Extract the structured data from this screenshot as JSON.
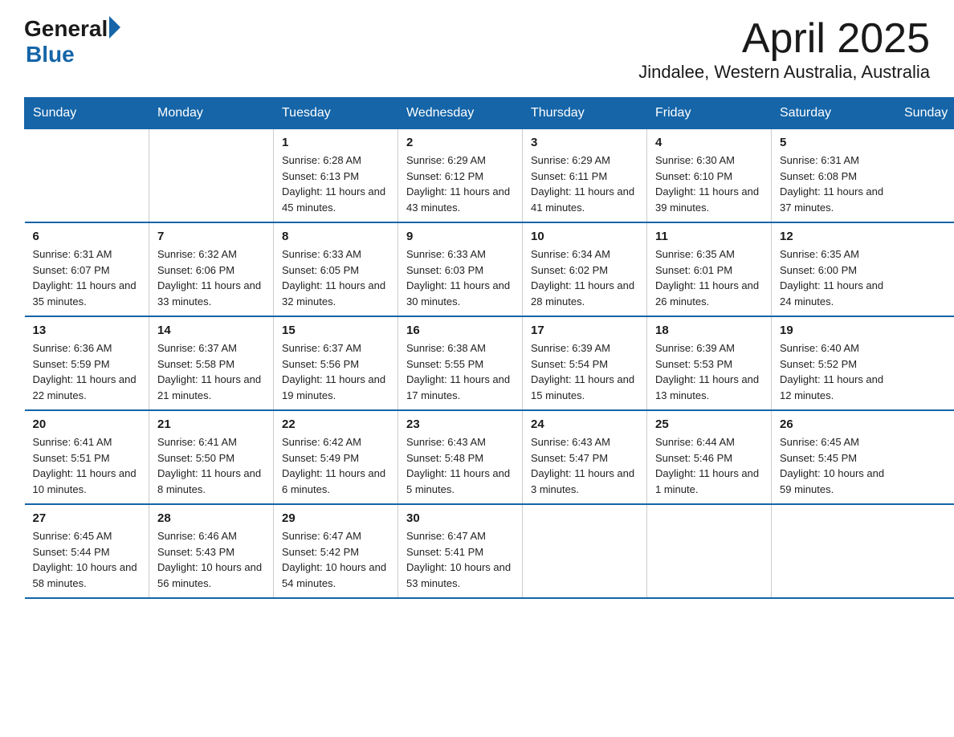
{
  "header": {
    "logo_general": "General",
    "logo_blue": "Blue",
    "month_title": "April 2025",
    "location": "Jindalee, Western Australia, Australia"
  },
  "days_of_week": [
    "Sunday",
    "Monday",
    "Tuesday",
    "Wednesday",
    "Thursday",
    "Friday",
    "Saturday"
  ],
  "weeks": [
    [
      {
        "day": "",
        "sunrise": "",
        "sunset": "",
        "daylight": ""
      },
      {
        "day": "",
        "sunrise": "",
        "sunset": "",
        "daylight": ""
      },
      {
        "day": "1",
        "sunrise": "Sunrise: 6:28 AM",
        "sunset": "Sunset: 6:13 PM",
        "daylight": "Daylight: 11 hours and 45 minutes."
      },
      {
        "day": "2",
        "sunrise": "Sunrise: 6:29 AM",
        "sunset": "Sunset: 6:12 PM",
        "daylight": "Daylight: 11 hours and 43 minutes."
      },
      {
        "day": "3",
        "sunrise": "Sunrise: 6:29 AM",
        "sunset": "Sunset: 6:11 PM",
        "daylight": "Daylight: 11 hours and 41 minutes."
      },
      {
        "day": "4",
        "sunrise": "Sunrise: 6:30 AM",
        "sunset": "Sunset: 6:10 PM",
        "daylight": "Daylight: 11 hours and 39 minutes."
      },
      {
        "day": "5",
        "sunrise": "Sunrise: 6:31 AM",
        "sunset": "Sunset: 6:08 PM",
        "daylight": "Daylight: 11 hours and 37 minutes."
      }
    ],
    [
      {
        "day": "6",
        "sunrise": "Sunrise: 6:31 AM",
        "sunset": "Sunset: 6:07 PM",
        "daylight": "Daylight: 11 hours and 35 minutes."
      },
      {
        "day": "7",
        "sunrise": "Sunrise: 6:32 AM",
        "sunset": "Sunset: 6:06 PM",
        "daylight": "Daylight: 11 hours and 33 minutes."
      },
      {
        "day": "8",
        "sunrise": "Sunrise: 6:33 AM",
        "sunset": "Sunset: 6:05 PM",
        "daylight": "Daylight: 11 hours and 32 minutes."
      },
      {
        "day": "9",
        "sunrise": "Sunrise: 6:33 AM",
        "sunset": "Sunset: 6:03 PM",
        "daylight": "Daylight: 11 hours and 30 minutes."
      },
      {
        "day": "10",
        "sunrise": "Sunrise: 6:34 AM",
        "sunset": "Sunset: 6:02 PM",
        "daylight": "Daylight: 11 hours and 28 minutes."
      },
      {
        "day": "11",
        "sunrise": "Sunrise: 6:35 AM",
        "sunset": "Sunset: 6:01 PM",
        "daylight": "Daylight: 11 hours and 26 minutes."
      },
      {
        "day": "12",
        "sunrise": "Sunrise: 6:35 AM",
        "sunset": "Sunset: 6:00 PM",
        "daylight": "Daylight: 11 hours and 24 minutes."
      }
    ],
    [
      {
        "day": "13",
        "sunrise": "Sunrise: 6:36 AM",
        "sunset": "Sunset: 5:59 PM",
        "daylight": "Daylight: 11 hours and 22 minutes."
      },
      {
        "day": "14",
        "sunrise": "Sunrise: 6:37 AM",
        "sunset": "Sunset: 5:58 PM",
        "daylight": "Daylight: 11 hours and 21 minutes."
      },
      {
        "day": "15",
        "sunrise": "Sunrise: 6:37 AM",
        "sunset": "Sunset: 5:56 PM",
        "daylight": "Daylight: 11 hours and 19 minutes."
      },
      {
        "day": "16",
        "sunrise": "Sunrise: 6:38 AM",
        "sunset": "Sunset: 5:55 PM",
        "daylight": "Daylight: 11 hours and 17 minutes."
      },
      {
        "day": "17",
        "sunrise": "Sunrise: 6:39 AM",
        "sunset": "Sunset: 5:54 PM",
        "daylight": "Daylight: 11 hours and 15 minutes."
      },
      {
        "day": "18",
        "sunrise": "Sunrise: 6:39 AM",
        "sunset": "Sunset: 5:53 PM",
        "daylight": "Daylight: 11 hours and 13 minutes."
      },
      {
        "day": "19",
        "sunrise": "Sunrise: 6:40 AM",
        "sunset": "Sunset: 5:52 PM",
        "daylight": "Daylight: 11 hours and 12 minutes."
      }
    ],
    [
      {
        "day": "20",
        "sunrise": "Sunrise: 6:41 AM",
        "sunset": "Sunset: 5:51 PM",
        "daylight": "Daylight: 11 hours and 10 minutes."
      },
      {
        "day": "21",
        "sunrise": "Sunrise: 6:41 AM",
        "sunset": "Sunset: 5:50 PM",
        "daylight": "Daylight: 11 hours and 8 minutes."
      },
      {
        "day": "22",
        "sunrise": "Sunrise: 6:42 AM",
        "sunset": "Sunset: 5:49 PM",
        "daylight": "Daylight: 11 hours and 6 minutes."
      },
      {
        "day": "23",
        "sunrise": "Sunrise: 6:43 AM",
        "sunset": "Sunset: 5:48 PM",
        "daylight": "Daylight: 11 hours and 5 minutes."
      },
      {
        "day": "24",
        "sunrise": "Sunrise: 6:43 AM",
        "sunset": "Sunset: 5:47 PM",
        "daylight": "Daylight: 11 hours and 3 minutes."
      },
      {
        "day": "25",
        "sunrise": "Sunrise: 6:44 AM",
        "sunset": "Sunset: 5:46 PM",
        "daylight": "Daylight: 11 hours and 1 minute."
      },
      {
        "day": "26",
        "sunrise": "Sunrise: 6:45 AM",
        "sunset": "Sunset: 5:45 PM",
        "daylight": "Daylight: 10 hours and 59 minutes."
      }
    ],
    [
      {
        "day": "27",
        "sunrise": "Sunrise: 6:45 AM",
        "sunset": "Sunset: 5:44 PM",
        "daylight": "Daylight: 10 hours and 58 minutes."
      },
      {
        "day": "28",
        "sunrise": "Sunrise: 6:46 AM",
        "sunset": "Sunset: 5:43 PM",
        "daylight": "Daylight: 10 hours and 56 minutes."
      },
      {
        "day": "29",
        "sunrise": "Sunrise: 6:47 AM",
        "sunset": "Sunset: 5:42 PM",
        "daylight": "Daylight: 10 hours and 54 minutes."
      },
      {
        "day": "30",
        "sunrise": "Sunrise: 6:47 AM",
        "sunset": "Sunset: 5:41 PM",
        "daylight": "Daylight: 10 hours and 53 minutes."
      },
      {
        "day": "",
        "sunrise": "",
        "sunset": "",
        "daylight": ""
      },
      {
        "day": "",
        "sunrise": "",
        "sunset": "",
        "daylight": ""
      },
      {
        "day": "",
        "sunrise": "",
        "sunset": "",
        "daylight": ""
      }
    ]
  ]
}
